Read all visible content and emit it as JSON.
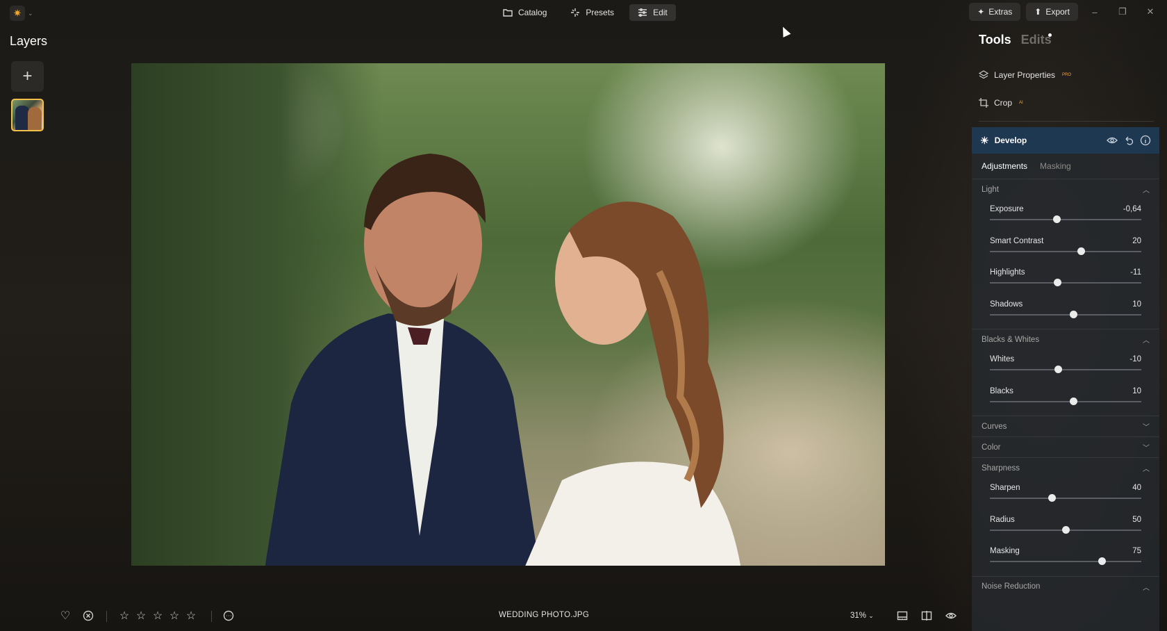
{
  "nav": {
    "catalog": "Catalog",
    "presets": "Presets",
    "edit": "Edit"
  },
  "top_right": {
    "extras": "Extras",
    "export": "Export"
  },
  "layers": {
    "title": "Layers"
  },
  "right_panel": {
    "tabs": {
      "tools": "Tools",
      "edits": "Edits"
    },
    "layer_properties": {
      "label": "Layer Properties",
      "badge": "PRO"
    },
    "crop": {
      "label": "Crop",
      "badge": "AI"
    },
    "develop": {
      "title": "Develop"
    },
    "subtabs": {
      "adjustments": "Adjustments",
      "masking": "Masking"
    },
    "light": {
      "title": "Light",
      "sliders": [
        {
          "label": "Exposure",
          "value": "-0,64",
          "fraction": 0.44
        },
        {
          "label": "Smart Contrast",
          "value": "20",
          "fraction": 0.6
        },
        {
          "label": "Highlights",
          "value": "-11",
          "fraction": 0.445
        },
        {
          "label": "Shadows",
          "value": "10",
          "fraction": 0.55
        }
      ]
    },
    "blacks_whites": {
      "title": "Blacks & Whites",
      "sliders": [
        {
          "label": "Whites",
          "value": "-10",
          "fraction": 0.45
        },
        {
          "label": "Blacks",
          "value": "10",
          "fraction": 0.55
        }
      ]
    },
    "curves": {
      "title": "Curves"
    },
    "color": {
      "title": "Color"
    },
    "sharpness": {
      "title": "Sharpness",
      "sliders": [
        {
          "label": "Sharpen",
          "value": "40",
          "fraction": 0.41
        },
        {
          "label": "Radius",
          "value": "50",
          "fraction": 0.5
        },
        {
          "label": "Masking",
          "value": "75",
          "fraction": 0.74
        }
      ]
    },
    "noise_reduction": {
      "title": "Noise Reduction"
    }
  },
  "bottom": {
    "filename": "WEDDING PHOTO.JPG",
    "zoom": "31%",
    "rating": 0
  },
  "colors": {
    "accent": "#f1a829",
    "panel_header": "#1f3852"
  }
}
